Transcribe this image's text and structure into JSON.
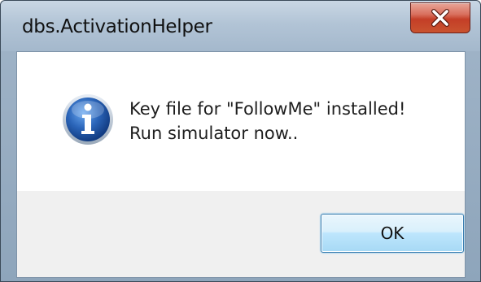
{
  "window": {
    "title": "dbs.ActivationHelper",
    "close_icon": "close-x-icon"
  },
  "dialog": {
    "icon": "information-icon",
    "message_line1": "Key file for \"FollowMe\" installed!",
    "message_line2": "Run simulator now.."
  },
  "buttons": {
    "ok_label": "OK"
  },
  "colors": {
    "close_button": "#c9432c",
    "info_icon": "#2a64b8",
    "ok_button_border": "#3c7fb1",
    "footer_bg": "#f0f0f0"
  }
}
